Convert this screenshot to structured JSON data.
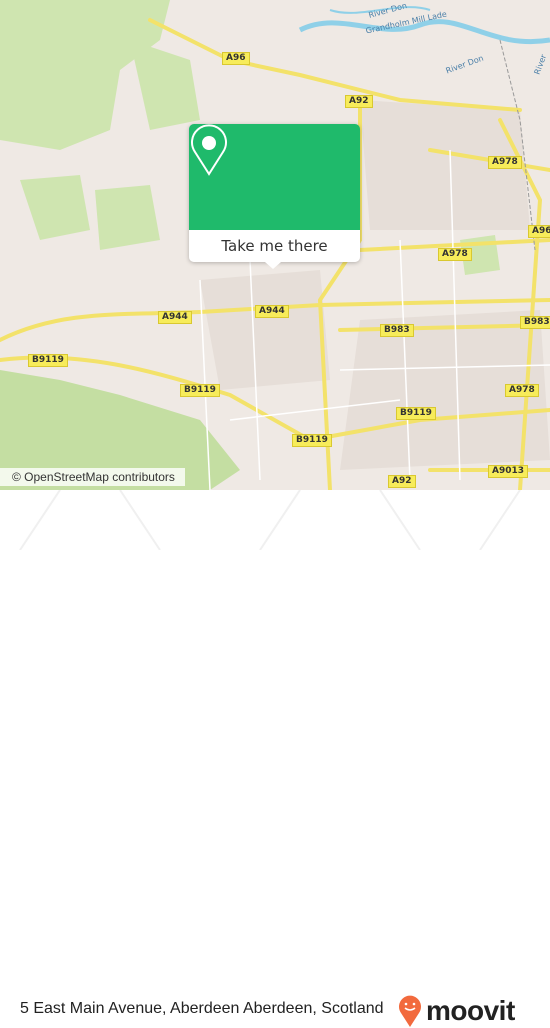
{
  "map": {
    "road_labels": [
      "A96",
      "A92",
      "A978",
      "A96",
      "A978",
      "A944",
      "A944",
      "B983",
      "B983",
      "B9119",
      "B9119",
      "A978",
      "B9119",
      "B9119",
      "A9013",
      "A92"
    ],
    "water_labels": [
      "Grandholm Mill Lade",
      "River Don",
      "River Don",
      "River"
    ],
    "attribution": "© OpenStreetMap contributors",
    "colors": {
      "land": "#efe9e4",
      "park": "#cfe5b0",
      "water": "#8fd0e8",
      "road_major": "#f3e26a",
      "popup": "#1fba6b",
      "brand": "#f26a3d"
    }
  },
  "popup": {
    "icon": "map-pin-icon",
    "button_label": "Take me there"
  },
  "footer": {
    "address": "5 East Main Avenue, Aberdeen Aberdeen, Scotland",
    "brand": "moovit"
  }
}
